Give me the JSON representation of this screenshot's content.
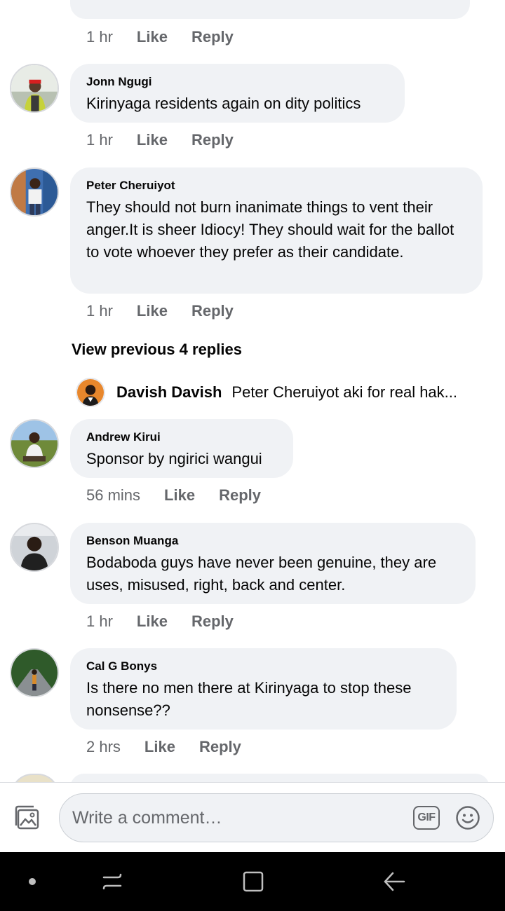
{
  "comments": [
    {
      "author": "",
      "text": "",
      "time": "1 hr",
      "like_label": "Like",
      "reply_label": "Reply"
    },
    {
      "author": "Jonn Ngugi",
      "text": "Kirinyaga residents again on dity politics",
      "time": "1 hr",
      "like_label": "Like",
      "reply_label": "Reply"
    },
    {
      "author": "Peter Cheruiyot",
      "text": "They should not burn inanimate things to vent their anger.It is sheer Idiocy! They should wait for the ballot to vote whoever they prefer as their candidate.",
      "time": "1 hr",
      "like_label": "Like",
      "reply_label": "Reply"
    },
    {
      "author": "Andrew Kirui",
      "text": "Sponsor by ngirici wangui",
      "time": "56 mins",
      "like_label": "Like",
      "reply_label": "Reply"
    },
    {
      "author": "Benson Muanga",
      "text": "Bodaboda guys have never been genuine, they are uses, misused, right, back and center.",
      "time": "1 hr",
      "like_label": "Like",
      "reply_label": "Reply"
    },
    {
      "author": "Cal G Bonys",
      "text": "Is there no men there at Kirinyaga to stop these nonsense??",
      "time": "2 hrs",
      "like_label": "Like",
      "reply_label": "Reply"
    }
  ],
  "view_previous": "View previous 4 replies",
  "reply_preview": {
    "author": "Davish Davish",
    "text": "Peter Cheruiyot aki for real hak..."
  },
  "composer": {
    "placeholder": "Write a comment…",
    "gif_label": "GIF"
  },
  "icons": {
    "photo": "photo-icon",
    "gif": "gif-icon",
    "emoji": "emoji-icon",
    "nav_dot": "nav-dot-icon",
    "recents": "recents-icon",
    "home": "home-icon",
    "back": "back-icon"
  },
  "colors": {
    "bubble": "#f0f2f5",
    "meta": "#65676b",
    "text": "#050505",
    "navbar": "#000000"
  }
}
